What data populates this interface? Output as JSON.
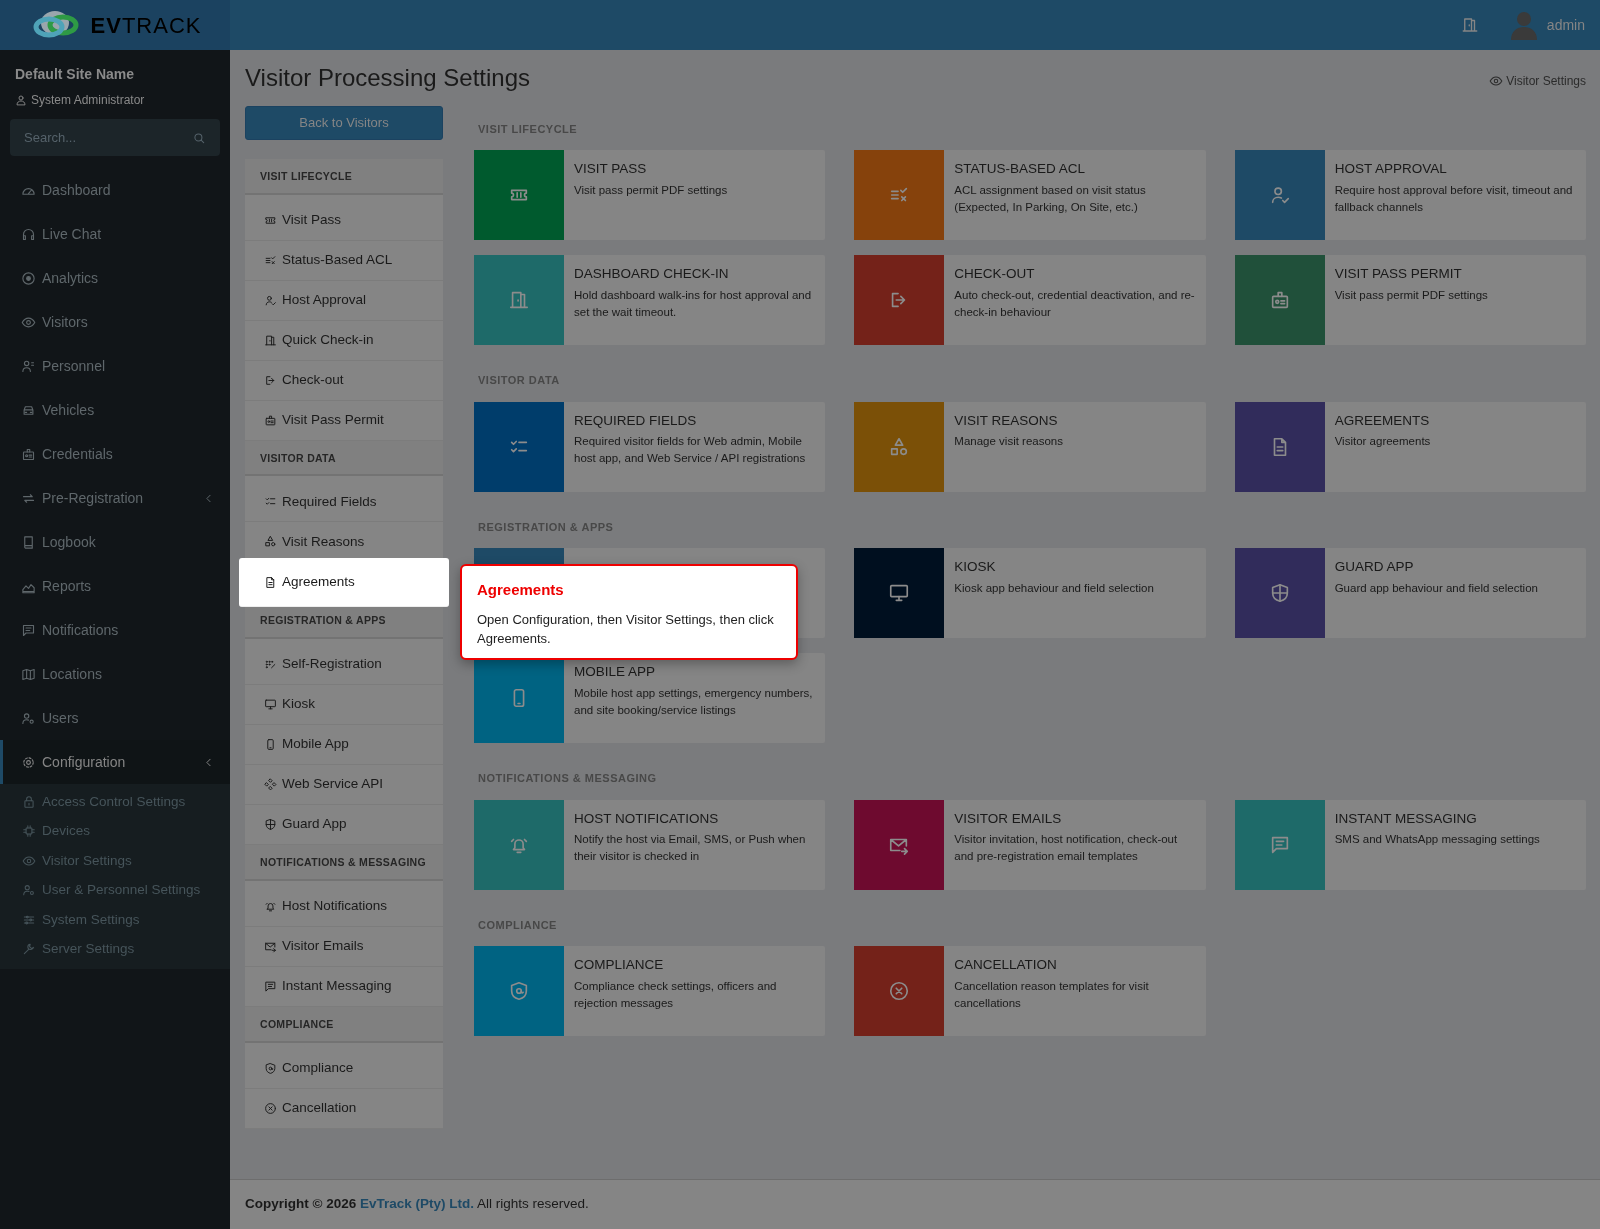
{
  "header": {
    "logo": "**EV**TRACK",
    "user": "admin"
  },
  "sidebar": {
    "site_name": "Default Site Name",
    "role": "System Administrator",
    "search": {
      "placeholder": "Search..."
    },
    "items": [
      {
        "label": "Dashboard",
        "selected": false
      },
      {
        "label": "Live Chat",
        "selected": false
      },
      {
        "label": "Analytics",
        "selected": false
      },
      {
        "label": "Visitors",
        "selected": false
      },
      {
        "label": "Personnel",
        "selected": false
      },
      {
        "label": "Vehicles",
        "selected": false
      },
      {
        "label": "Credentials",
        "selected": false
      },
      {
        "label": "Pre-Registration",
        "selected": false,
        "kind": "group"
      },
      {
        "label": "Logbook",
        "selected": false
      },
      {
        "label": "Reports",
        "selected": false
      },
      {
        "label": "Notifications",
        "selected": false
      },
      {
        "label": "Locations",
        "selected": false
      },
      {
        "label": "Users",
        "selected": false
      },
      {
        "label": "Configuration",
        "selected": true,
        "kind": "group",
        "children": [
          {
            "label": "Access Control Settings",
            "selected": false
          },
          {
            "label": "Devices",
            "selected": false
          },
          {
            "label": "Visitor Settings",
            "selected": false
          },
          {
            "label": "User & Personnel Settings",
            "selected": false
          },
          {
            "label": "System Settings",
            "selected": false
          },
          {
            "label": "Server Settings",
            "selected": false
          }
        ]
      }
    ]
  },
  "page": {
    "title": "Visitor Processing Settings",
    "header_link": "Visitor Settings",
    "back_button": "Back to Visitors"
  },
  "menu": [
    {
      "heading": "VISIT LIFECYCLE",
      "items": [
        {
          "label": "Visit Pass",
          "highlighted": false
        },
        {
          "label": "Status-Based ACL",
          "highlighted": false
        },
        {
          "label": "Host Approval",
          "highlighted": false
        },
        {
          "label": "Quick Check-in",
          "highlighted": false
        },
        {
          "label": "Check-out",
          "highlighted": false
        },
        {
          "label": "Visit Pass Permit",
          "highlighted": false
        }
      ]
    },
    {
      "heading": "VISITOR DATA",
      "items": [
        {
          "label": "Required Fields",
          "highlighted": false
        },
        {
          "label": "Visit Reasons",
          "highlighted": false
        },
        {
          "label": "Agreements",
          "highlighted": true
        }
      ]
    },
    {
      "heading": "REGISTRATION & APPS",
      "items": [
        {
          "label": "Self-Registration",
          "highlighted": false
        },
        {
          "label": "Kiosk",
          "highlighted": false
        },
        {
          "label": "Mobile App",
          "highlighted": false
        },
        {
          "label": "Web Service API",
          "highlighted": false
        },
        {
          "label": "Guard App",
          "highlighted": false
        }
      ]
    },
    {
      "heading": "NOTIFICATIONS & MESSAGING",
      "items": [
        {
          "label": "Host Notifications",
          "highlighted": false
        },
        {
          "label": "Visitor Emails",
          "highlighted": false
        },
        {
          "label": "Instant Messaging",
          "highlighted": false
        }
      ]
    },
    {
      "heading": "COMPLIANCE",
      "items": [
        {
          "label": "Compliance",
          "highlighted": false
        },
        {
          "label": "Cancellation",
          "highlighted": false
        }
      ]
    }
  ],
  "sections": [
    {
      "heading": "VISIT LIFECYCLE",
      "cards": [
        {
          "title": "VISIT PASS",
          "description": "Visit pass permit PDF settings",
          "color": "#005a2e"
        },
        {
          "title": "STATUS-BASED ACL",
          "description": "ACL assignment based on visit status (Expected, In Parking, On Site, etc.)",
          "color": "#86420c"
        },
        {
          "title": "HOST APPROVAL",
          "description": "Require host approval before visit, timeout and fallback channels",
          "color": "#1e4a66"
        },
        {
          "title": "DASHBOARD CHECK-IN",
          "description": "Hold dashboard walk-ins for host approval and set the wait timeout.",
          "color": "#1e6a69"
        },
        {
          "title": "CHECK-OUT",
          "description": "Auto check-out, credential deactivation, and re-check-in behaviour",
          "color": "#742219"
        },
        {
          "title": "VISIT PASS PERMIT",
          "description": "Visit pass permit PDF settings",
          "color": "#20503a"
        }
      ]
    },
    {
      "heading": "VISITOR DATA",
      "cards": [
        {
          "title": "REQUIRED FIELDS",
          "description": "Required visitor fields for Web admin, Mobile host app, and Web Service / API registrations",
          "color": "#003d6b"
        },
        {
          "title": "VISIT REASONS",
          "description": "Manage visit reasons",
          "color": "#7b5007"
        },
        {
          "title": "AGREEMENTS",
          "description": "Visitor agreements",
          "color": "#312c5b"
        }
      ]
    },
    {
      "heading": "REGISTRATION & APPS",
      "cards": [
        {
          "color": "#1e4a66"
        },
        {
          "title": "KIOSK",
          "description": "Kiosk app behaviour and field selection",
          "color": "#000f1f"
        },
        {
          "title": "GUARD APP",
          "description": "Guard app behaviour and field selection",
          "color": "#312c5b"
        },
        {
          "title": "MOBILE APP",
          "description": "Mobile host app settings, emergency numbers, and site booking/service listings",
          "color": "#006382"
        }
      ]
    },
    {
      "heading": "NOTIFICATIONS & MESSAGING",
      "cards": [
        {
          "title": "HOST NOTIFICATIONS",
          "description": "Notify the host via Email, SMS, or Push when their visitor is checked in",
          "color": "#1e6a69"
        },
        {
          "title": "VISITOR EMAILS",
          "description": "Visitor invitation, host notification, check-out and pre-registration email templates",
          "color": "#6e0a2f"
        },
        {
          "title": "INSTANT MESSAGING",
          "description": "SMS and WhatsApp messaging settings",
          "color": "#1e6a69"
        }
      ]
    },
    {
      "heading": "COMPLIANCE",
      "cards": [
        {
          "title": "COMPLIANCE",
          "description": "Compliance check settings, officers and rejection messages",
          "color": "#006382"
        },
        {
          "title": "CANCELLATION",
          "description": "Cancellation reason templates for visit cancellations",
          "color": "#742219"
        }
      ]
    }
  ],
  "tooltip": {
    "title": "Agreements",
    "text": "Open Configuration, then Visitor Settings, then click Agreements."
  },
  "footer": {
    "prefix": "Copyright © 2026",
    "link": "EvTrack (Pty) Ltd.",
    "suffix": "All rights reserved."
  }
}
